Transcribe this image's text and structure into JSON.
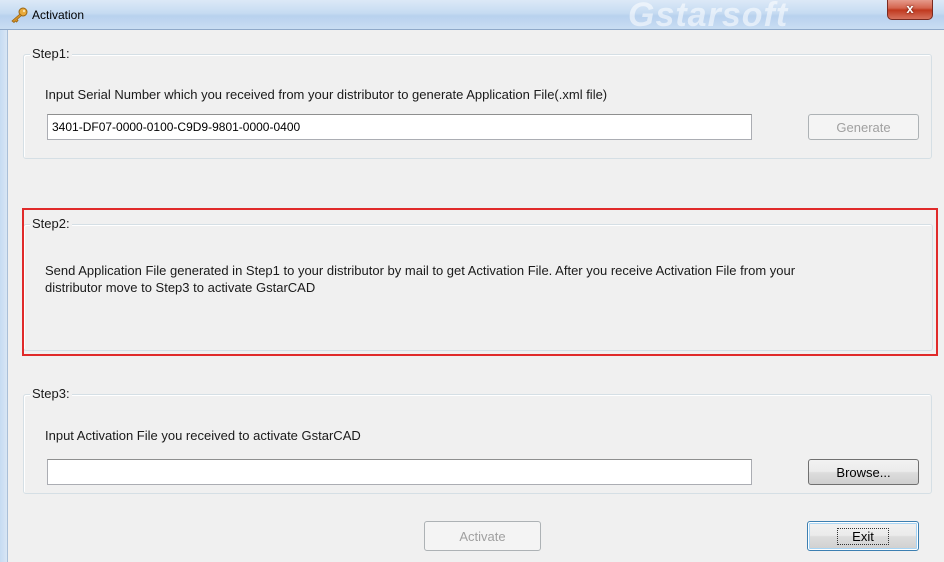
{
  "window": {
    "title": "Activation",
    "watermark": "Gstarsoft",
    "close_label": "x"
  },
  "step1": {
    "legend": "Step1:",
    "instruction": "Input Serial Number which you received from your distributor to generate Application File(.xml file)",
    "serial_value": "3401-DF07-0000-0100-C9D9-9801-0000-0400",
    "generate_label": "Generate"
  },
  "step2": {
    "legend": "Step2:",
    "instruction_line1": "Send Application File generated in Step1 to your distributor by mail to get Activation File. After you receive Activation File from your",
    "instruction_line2": "distributor move to Step3 to activate GstarCAD",
    "highlight_color": "#e02a2a"
  },
  "step3": {
    "legend": "Step3:",
    "instruction": "Input Activation File you received to activate GstarCAD",
    "file_value": "",
    "browse_label": "Browse..."
  },
  "footer": {
    "activate_label": "Activate",
    "exit_label": "Exit"
  },
  "icons": {
    "title_icon": "key-icon",
    "close_icon": "close-icon"
  }
}
